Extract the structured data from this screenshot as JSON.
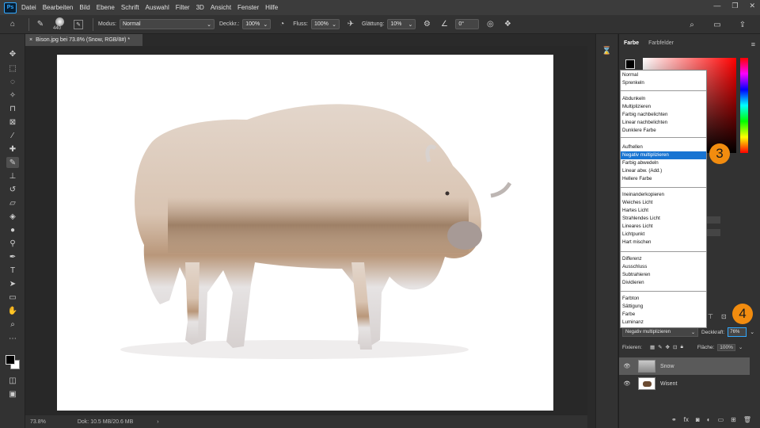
{
  "menubar": {
    "items": [
      "Datei",
      "Bearbeiten",
      "Bild",
      "Ebene",
      "Schrift",
      "Auswahl",
      "Filter",
      "3D",
      "Ansicht",
      "Fenster",
      "Hilfe"
    ]
  },
  "options": {
    "brush_size": "440",
    "mode_label": "Modus:",
    "mode_value": "Normal",
    "opacity_label": "Deckkr.:",
    "opacity_value": "100%",
    "flow_label": "Fluss:",
    "flow_value": "100%",
    "smoothing_label": "Glättung:",
    "smoothing_value": "10%",
    "angle_value": "0°"
  },
  "document": {
    "tab_title": "Bison.jpg bei 73.8% (Snow, RGB/8#) *"
  },
  "status": {
    "zoom": "73.8%",
    "doc_size": "Dok: 10.5 MB/20.6 MB"
  },
  "color_panel": {
    "tabs": [
      "Farbe",
      "Farbfelder"
    ]
  },
  "blend_modes": {
    "selected_index": 9,
    "groups": [
      [
        "Normal",
        "Sprenkeln"
      ],
      [
        "Abdunkeln",
        "Multiplizieren",
        "Farbig nachbelichten",
        "Linear nachbelichten",
        "Dunklere Farbe"
      ],
      [
        "Aufhellen",
        "Negativ multiplizieren",
        "Farbig abwedeln",
        "Linear abw. (Add.)",
        "Hellere Farbe"
      ],
      [
        "Ineinanderkopieren",
        "Weiches Licht",
        "Hartes Licht",
        "Strahlendes Licht",
        "Lineares Licht",
        "Lichtpunkt",
        "Hart mischen"
      ],
      [
        "Differenz",
        "Ausschluss",
        "Subtrahieren",
        "Dividieren"
      ],
      [
        "Farbton",
        "Sättigung",
        "Farbe",
        "Luminanz"
      ]
    ]
  },
  "layers_panel": {
    "blend_value": "Negativ multiplizieren",
    "opacity_label": "Deckkraft:",
    "opacity_value": "76%",
    "lock_label": "Fixieren:",
    "fill_label": "Fläche:",
    "fill_value": "100%",
    "layers": [
      {
        "name": "Snow",
        "selected": true
      },
      {
        "name": "Wisent",
        "selected": false
      }
    ]
  },
  "callouts": [
    "3",
    "4"
  ],
  "colors": {
    "accent": "#31a8ff",
    "callout": "#f28c0f",
    "selection": "#1874d2"
  }
}
